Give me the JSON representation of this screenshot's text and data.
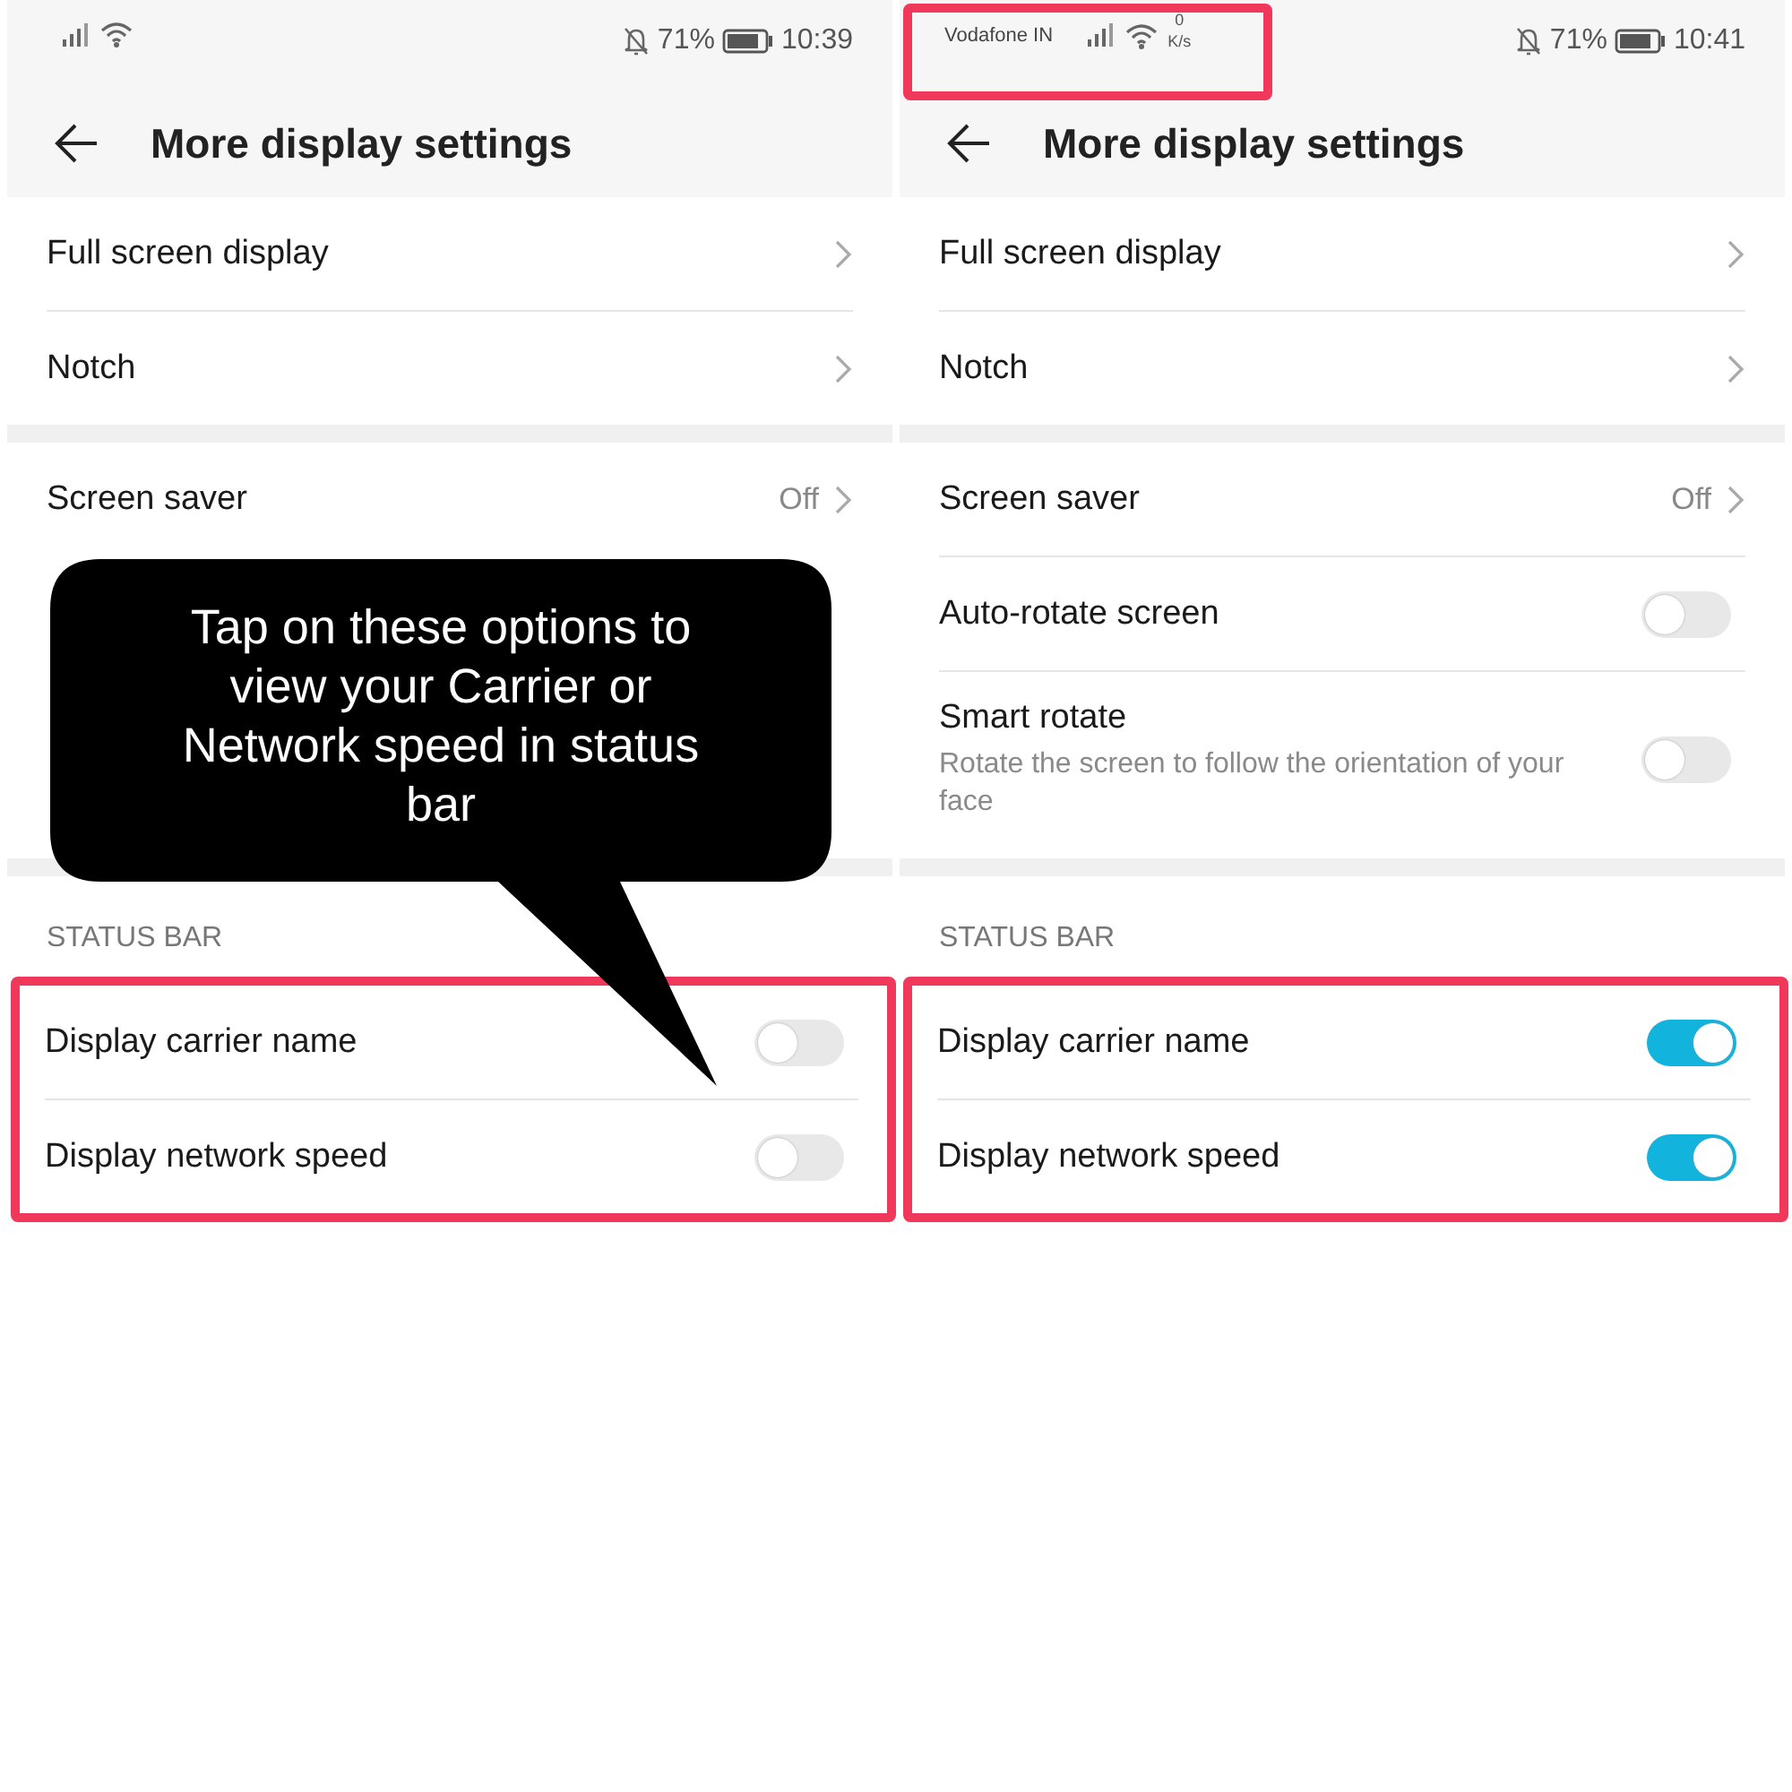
{
  "panels": [
    {
      "status_bar": {
        "highlighted": false,
        "battery": "71%",
        "time": "10:39"
      },
      "title": "More display settings",
      "sections": [
        {
          "rows": [
            {
              "kind": "link",
              "label": "Full screen display"
            },
            {
              "kind": "link",
              "label": "Notch"
            }
          ]
        },
        {
          "rows": [
            {
              "kind": "link",
              "label": "Screen saver",
              "value": "Off"
            }
          ]
        }
      ],
      "status_section": {
        "header": "STATUS BAR",
        "highlighted": true,
        "rows": [
          {
            "kind": "toggle",
            "label": "Display carrier name",
            "on": false
          },
          {
            "kind": "toggle",
            "label": "Display network speed",
            "on": false
          }
        ]
      }
    },
    {
      "status_bar": {
        "highlighted": true,
        "carrier": "Vodafone IN",
        "speed_value": "0",
        "speed_unit": "K/s",
        "battery": "71%",
        "time": "10:41"
      },
      "title": "More display settings",
      "sections": [
        {
          "rows": [
            {
              "kind": "link",
              "label": "Full screen display"
            },
            {
              "kind": "link",
              "label": "Notch"
            }
          ]
        },
        {
          "rows": [
            {
              "kind": "link",
              "label": "Screen saver",
              "value": "Off"
            },
            {
              "kind": "toggle",
              "label": "Auto-rotate screen",
              "on": false
            },
            {
              "kind": "toggle",
              "label": "Smart rotate",
              "description": "Rotate the screen to follow the orientation of your face",
              "on": false
            }
          ]
        }
      ],
      "status_section": {
        "header": "STATUS BAR",
        "highlighted": true,
        "rows": [
          {
            "kind": "toggle",
            "label": "Display carrier name",
            "on": true
          },
          {
            "kind": "toggle",
            "label": "Display network speed",
            "on": true
          }
        ]
      }
    }
  ],
  "callout": {
    "text": "Tap on these options to view your Carrier or Network speed in status bar"
  }
}
